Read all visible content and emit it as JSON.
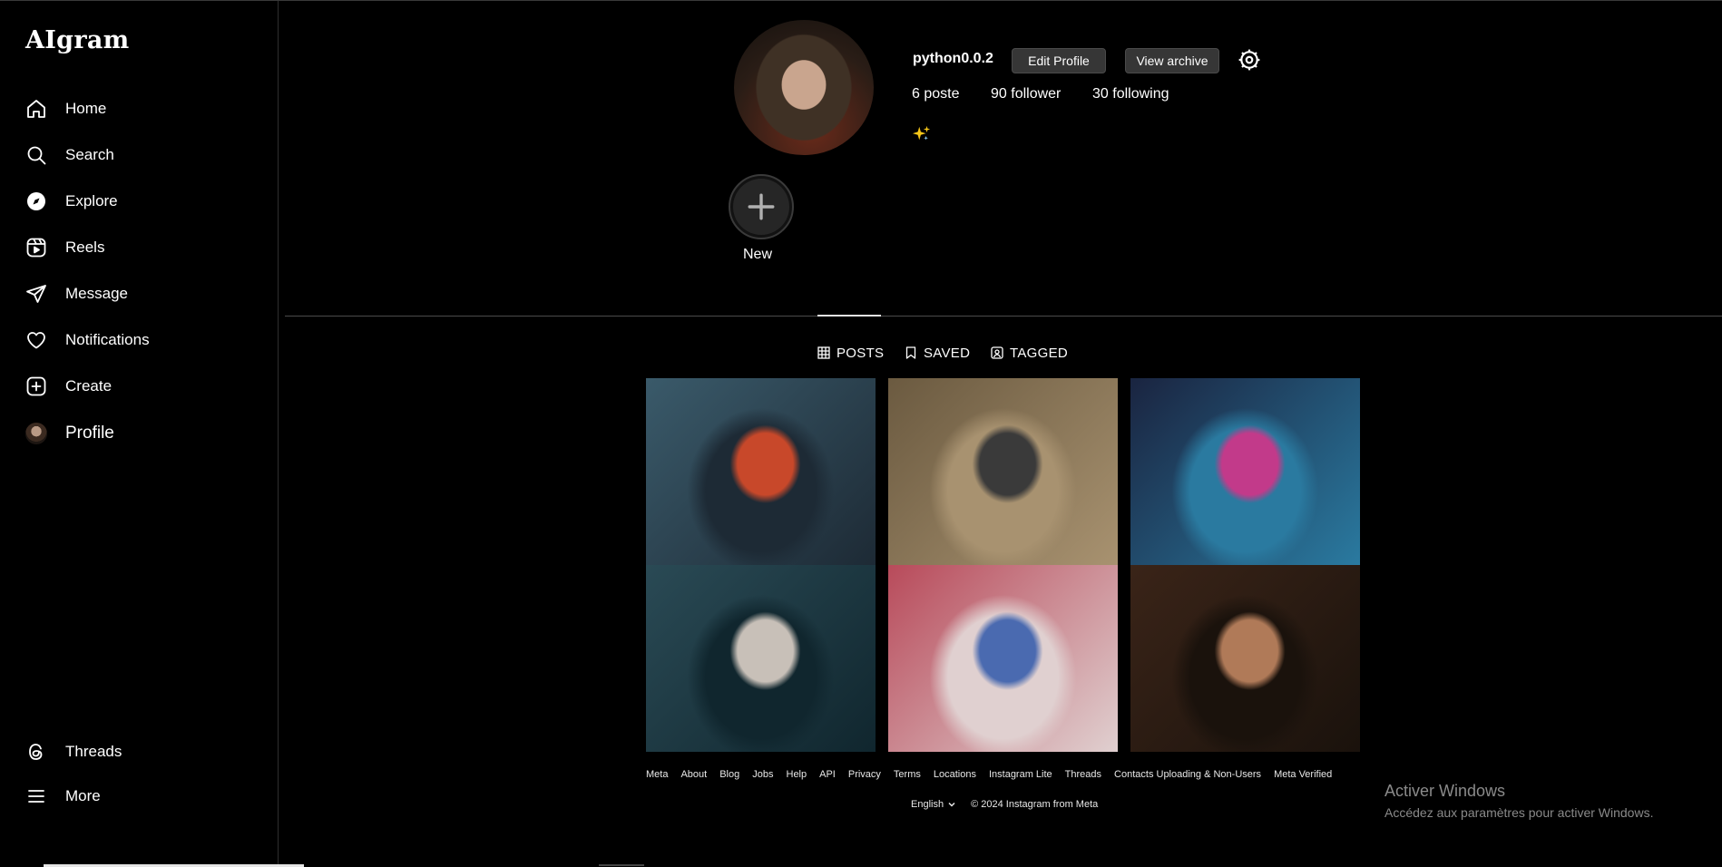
{
  "app": {
    "logo": "AIgram"
  },
  "sidebar": {
    "items": [
      {
        "label": "Home",
        "icon": "home-icon"
      },
      {
        "label": "Search",
        "icon": "search-icon"
      },
      {
        "label": "Explore",
        "icon": "compass-icon"
      },
      {
        "label": "Reels",
        "icon": "reels-icon"
      },
      {
        "label": "Message",
        "icon": "send-icon"
      },
      {
        "label": "Notifications",
        "icon": "heart-icon"
      },
      {
        "label": "Create",
        "icon": "plus-square-icon"
      },
      {
        "label": "Profile",
        "icon": "avatar"
      }
    ],
    "bottom_items": [
      {
        "label": "Threads",
        "icon": "threads-icon"
      },
      {
        "label": "More",
        "icon": "menu-icon"
      }
    ]
  },
  "profile": {
    "username": "python0.0.2",
    "edit_label": "Edit Profile",
    "archive_label": "View archive",
    "settings_icon": "gear-icon",
    "posts_count": "6 poste",
    "followers": "90 follower",
    "following": "30 following",
    "bio": "✨"
  },
  "stories": {
    "new_label": "New"
  },
  "tabs": [
    {
      "label": "POSTS",
      "icon": "grid-icon",
      "active": true
    },
    {
      "label": "SAVED",
      "icon": "bookmark-icon",
      "active": false
    },
    {
      "label": "TAGGED",
      "icon": "tag-icon",
      "active": false
    }
  ],
  "posts": [
    {
      "theme": "cyberpunk-red-hair",
      "colors": [
        "#3a5a6a",
        "#c8482a",
        "#1d2a35"
      ]
    },
    {
      "theme": "soldier-purple-hair",
      "colors": [
        "#6b5a40",
        "#3a3a3a",
        "#a89270"
      ]
    },
    {
      "theme": "neon-city-cyborg",
      "colors": [
        "#1a2440",
        "#c23a8a",
        "#2a7aa0"
      ]
    },
    {
      "theme": "silver-hair-android",
      "colors": [
        "#2a4a55",
        "#c8c0b8",
        "#10262e"
      ]
    },
    {
      "theme": "hooded-paint-splash",
      "colors": [
        "#b84a5a",
        "#4a6ab0",
        "#e0d0d0"
      ]
    },
    {
      "theme": "hooded-woman-portrait",
      "colors": [
        "#3a2418",
        "#b07a58",
        "#1a120c"
      ]
    }
  ],
  "footer": {
    "links": [
      "Meta",
      "About",
      "Blog",
      "Jobs",
      "Help",
      "API",
      "Privacy",
      "Terms",
      "Locations",
      "Instagram Lite",
      "Threads",
      "Contacts Uploading & Non-Users",
      "Meta Verified"
    ],
    "language": "English",
    "copyright": "© 2024 Instagram from Meta"
  },
  "windows_watermark": {
    "title": "Activer Windows",
    "subtitle": "Accédez aux paramètres pour activer Windows."
  }
}
